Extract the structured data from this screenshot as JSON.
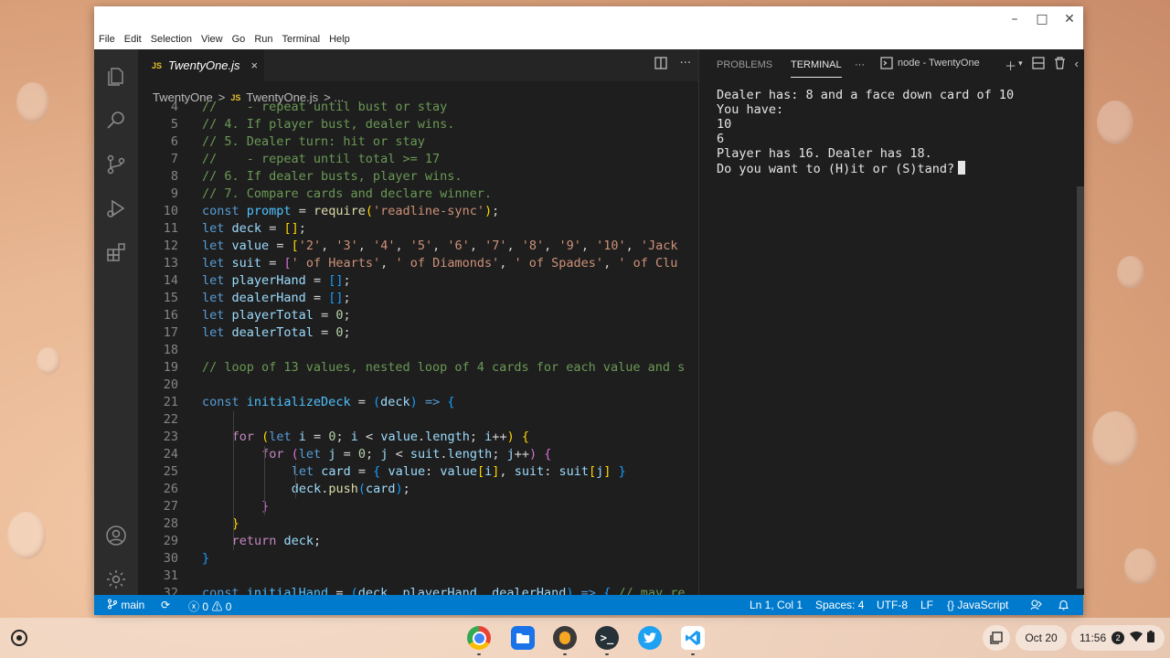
{
  "window": {
    "menu": [
      "File",
      "Edit",
      "Selection",
      "View",
      "Go",
      "Run",
      "Terminal",
      "Help"
    ],
    "controls": {
      "minimize": "–",
      "maximize": "□",
      "close": "✕"
    }
  },
  "editor": {
    "tab": {
      "badge": "JS",
      "name": "TwentyOne.js",
      "close": "×"
    },
    "breadcrumb": {
      "folder": "TwentyOne",
      "sep": ">",
      "badge": "JS",
      "file": "TwentyOne.js",
      "more": "> ..."
    },
    "code_lines": [
      {
        "n": "4",
        "code": "//    - repeat until bust or stay"
      },
      {
        "n": "5",
        "code": "// 4. If player bust, dealer wins."
      },
      {
        "n": "6",
        "code": "// 5. Dealer turn: hit or stay"
      },
      {
        "n": "7",
        "code": "//    - repeat until total >= 17"
      },
      {
        "n": "8",
        "code": "// 6. If dealer busts, player wins."
      },
      {
        "n": "9",
        "code": "// 7. Compare cards and declare winner."
      },
      {
        "n": "10",
        "code": "const prompt = require('readline-sync');"
      },
      {
        "n": "11",
        "code": "let deck = [];"
      },
      {
        "n": "12",
        "code": "let value = ['2', '3', '4', '5', '6', '7', '8', '9', '10', 'Jack"
      },
      {
        "n": "13",
        "code": "let suit = [' of Hearts', ' of Diamonds', ' of Spades', ' of Clu"
      },
      {
        "n": "14",
        "code": "let playerHand = [];"
      },
      {
        "n": "15",
        "code": "let dealerHand = [];"
      },
      {
        "n": "16",
        "code": "let playerTotal = 0;"
      },
      {
        "n": "17",
        "code": "let dealerTotal = 0;"
      },
      {
        "n": "18",
        "code": ""
      },
      {
        "n": "19",
        "code": "// loop of 13 values, nested loop of 4 cards for each value and s"
      },
      {
        "n": "20",
        "code": ""
      },
      {
        "n": "21",
        "code": "const initializeDeck = (deck) => {"
      },
      {
        "n": "22",
        "code": ""
      },
      {
        "n": "23",
        "code": "    for (let i = 0; i < value.length; i++) {"
      },
      {
        "n": "24",
        "code": "        for (let j = 0; j < suit.length; j++) {"
      },
      {
        "n": "25",
        "code": "            let card = { value: value[i], suit: suit[j] }"
      },
      {
        "n": "26",
        "code": "            deck.push(card);"
      },
      {
        "n": "27",
        "code": "        }"
      },
      {
        "n": "28",
        "code": "    }"
      },
      {
        "n": "29",
        "code": "    return deck;"
      },
      {
        "n": "30",
        "code": "}"
      },
      {
        "n": "31",
        "code": ""
      },
      {
        "n": "32",
        "code": "const initialHand = (deck, playerHand, dealerHand) => { // may re"
      }
    ]
  },
  "panel": {
    "tabs": [
      "PROBLEMS",
      "TERMINAL"
    ],
    "more": "···",
    "terminal_name": "node - TwentyOne",
    "output": [
      "Dealer has: 8 and a face down card of 10",
      "You have:",
      "10",
      "6",
      "Player has 16. Dealer has 18.",
      "Do you want to (H)it or (S)tand?"
    ]
  },
  "statusbar": {
    "branch": "main",
    "errors": "0",
    "warnings": "0",
    "position": "Ln 1, Col 1",
    "spaces": "Spaces: 4",
    "encoding": "UTF-8",
    "eol": "LF",
    "language": "JavaScript",
    "language_icon": "{}"
  },
  "shelf": {
    "date": "Oct 20",
    "time": "11:56",
    "notifications": "2"
  },
  "colors": {
    "statusbar": "#007acc",
    "editor_bg": "#1e1e1e",
    "activitybar": "#2c2c2c"
  }
}
